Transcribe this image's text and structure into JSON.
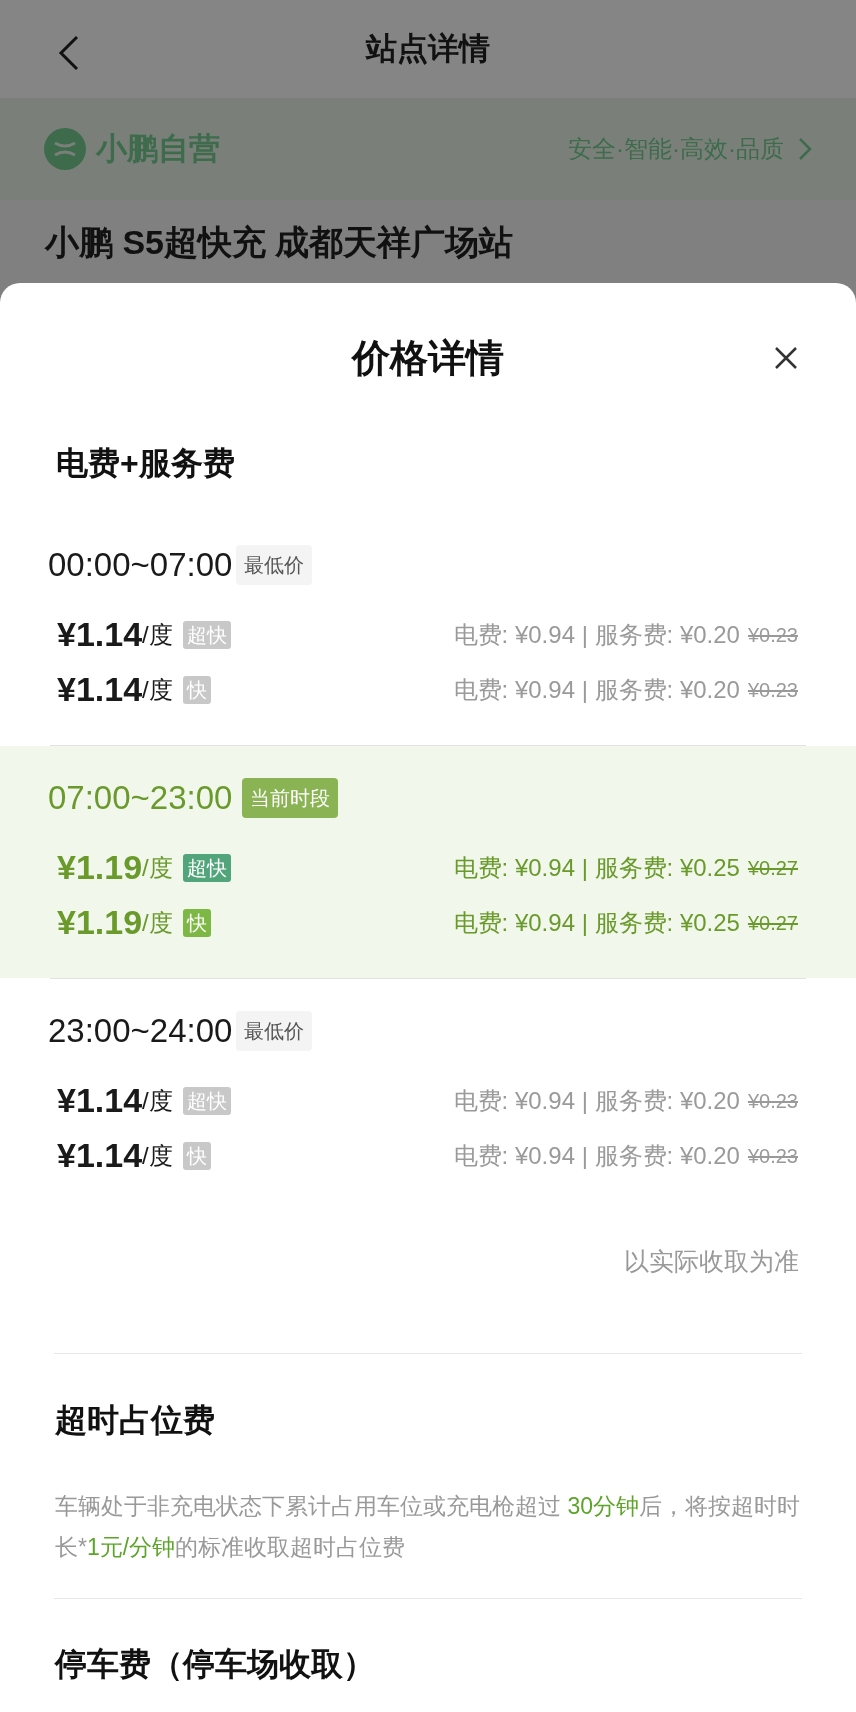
{
  "header": {
    "title": "站点详情"
  },
  "brand": {
    "name": "小鹏自营",
    "slogan": "安全·智能·高效·品质"
  },
  "station_name": "小鹏 S5超快充 成都天祥广场站",
  "sheet": {
    "title": "价格详情",
    "section_title": "电费+服务费",
    "periods": [
      {
        "time": "00:00~07:00",
        "badge": "最低价",
        "selected": false,
        "rates": [
          {
            "price": "¥1.14",
            "unit": "/度",
            "tag": "超快",
            "kind": "superfast",
            "detail": "电费: ¥0.94 | 服务费: ¥0.20",
            "original": "¥0.23"
          },
          {
            "price": "¥1.14",
            "unit": "/度",
            "tag": "快",
            "kind": "fast",
            "detail": "电费: ¥0.94 | 服务费: ¥0.20",
            "original": "¥0.23"
          }
        ]
      },
      {
        "time": "07:00~23:00",
        "badge": "当前时段",
        "selected": true,
        "rates": [
          {
            "price": "¥1.19",
            "unit": "/度",
            "tag": "超快",
            "kind": "superfast",
            "detail": "电费: ¥0.94 | 服务费: ¥0.25",
            "original": "¥0.27"
          },
          {
            "price": "¥1.19",
            "unit": "/度",
            "tag": "快",
            "kind": "fast",
            "detail": "电费: ¥0.94 | 服务费: ¥0.25",
            "original": "¥0.27"
          }
        ]
      },
      {
        "time": "23:00~24:00",
        "badge": "最低价",
        "selected": false,
        "rates": [
          {
            "price": "¥1.14",
            "unit": "/度",
            "tag": "超快",
            "kind": "superfast",
            "detail": "电费: ¥0.94 | 服务费: ¥0.20",
            "original": "¥0.23"
          },
          {
            "price": "¥1.14",
            "unit": "/度",
            "tag": "快",
            "kind": "fast",
            "detail": "电费: ¥0.94 | 服务费: ¥0.20",
            "original": "¥0.23"
          }
        ]
      }
    ],
    "note": "以实际收取为准",
    "overtime": {
      "title": "超时占位费",
      "segments": [
        {
          "text": "车辆处于非充电状态下累计占用车位或充电枪超过 ",
          "highlight": false
        },
        {
          "text": "30分钟",
          "highlight": true
        },
        {
          "text": "后，将按超时时长*",
          "highlight": false
        },
        {
          "text": "1元/分钟",
          "highlight": true
        },
        {
          "text": "的标准收取超时占位费",
          "highlight": false
        }
      ]
    },
    "parking": {
      "title": "停车费（停车场收取）"
    }
  }
}
